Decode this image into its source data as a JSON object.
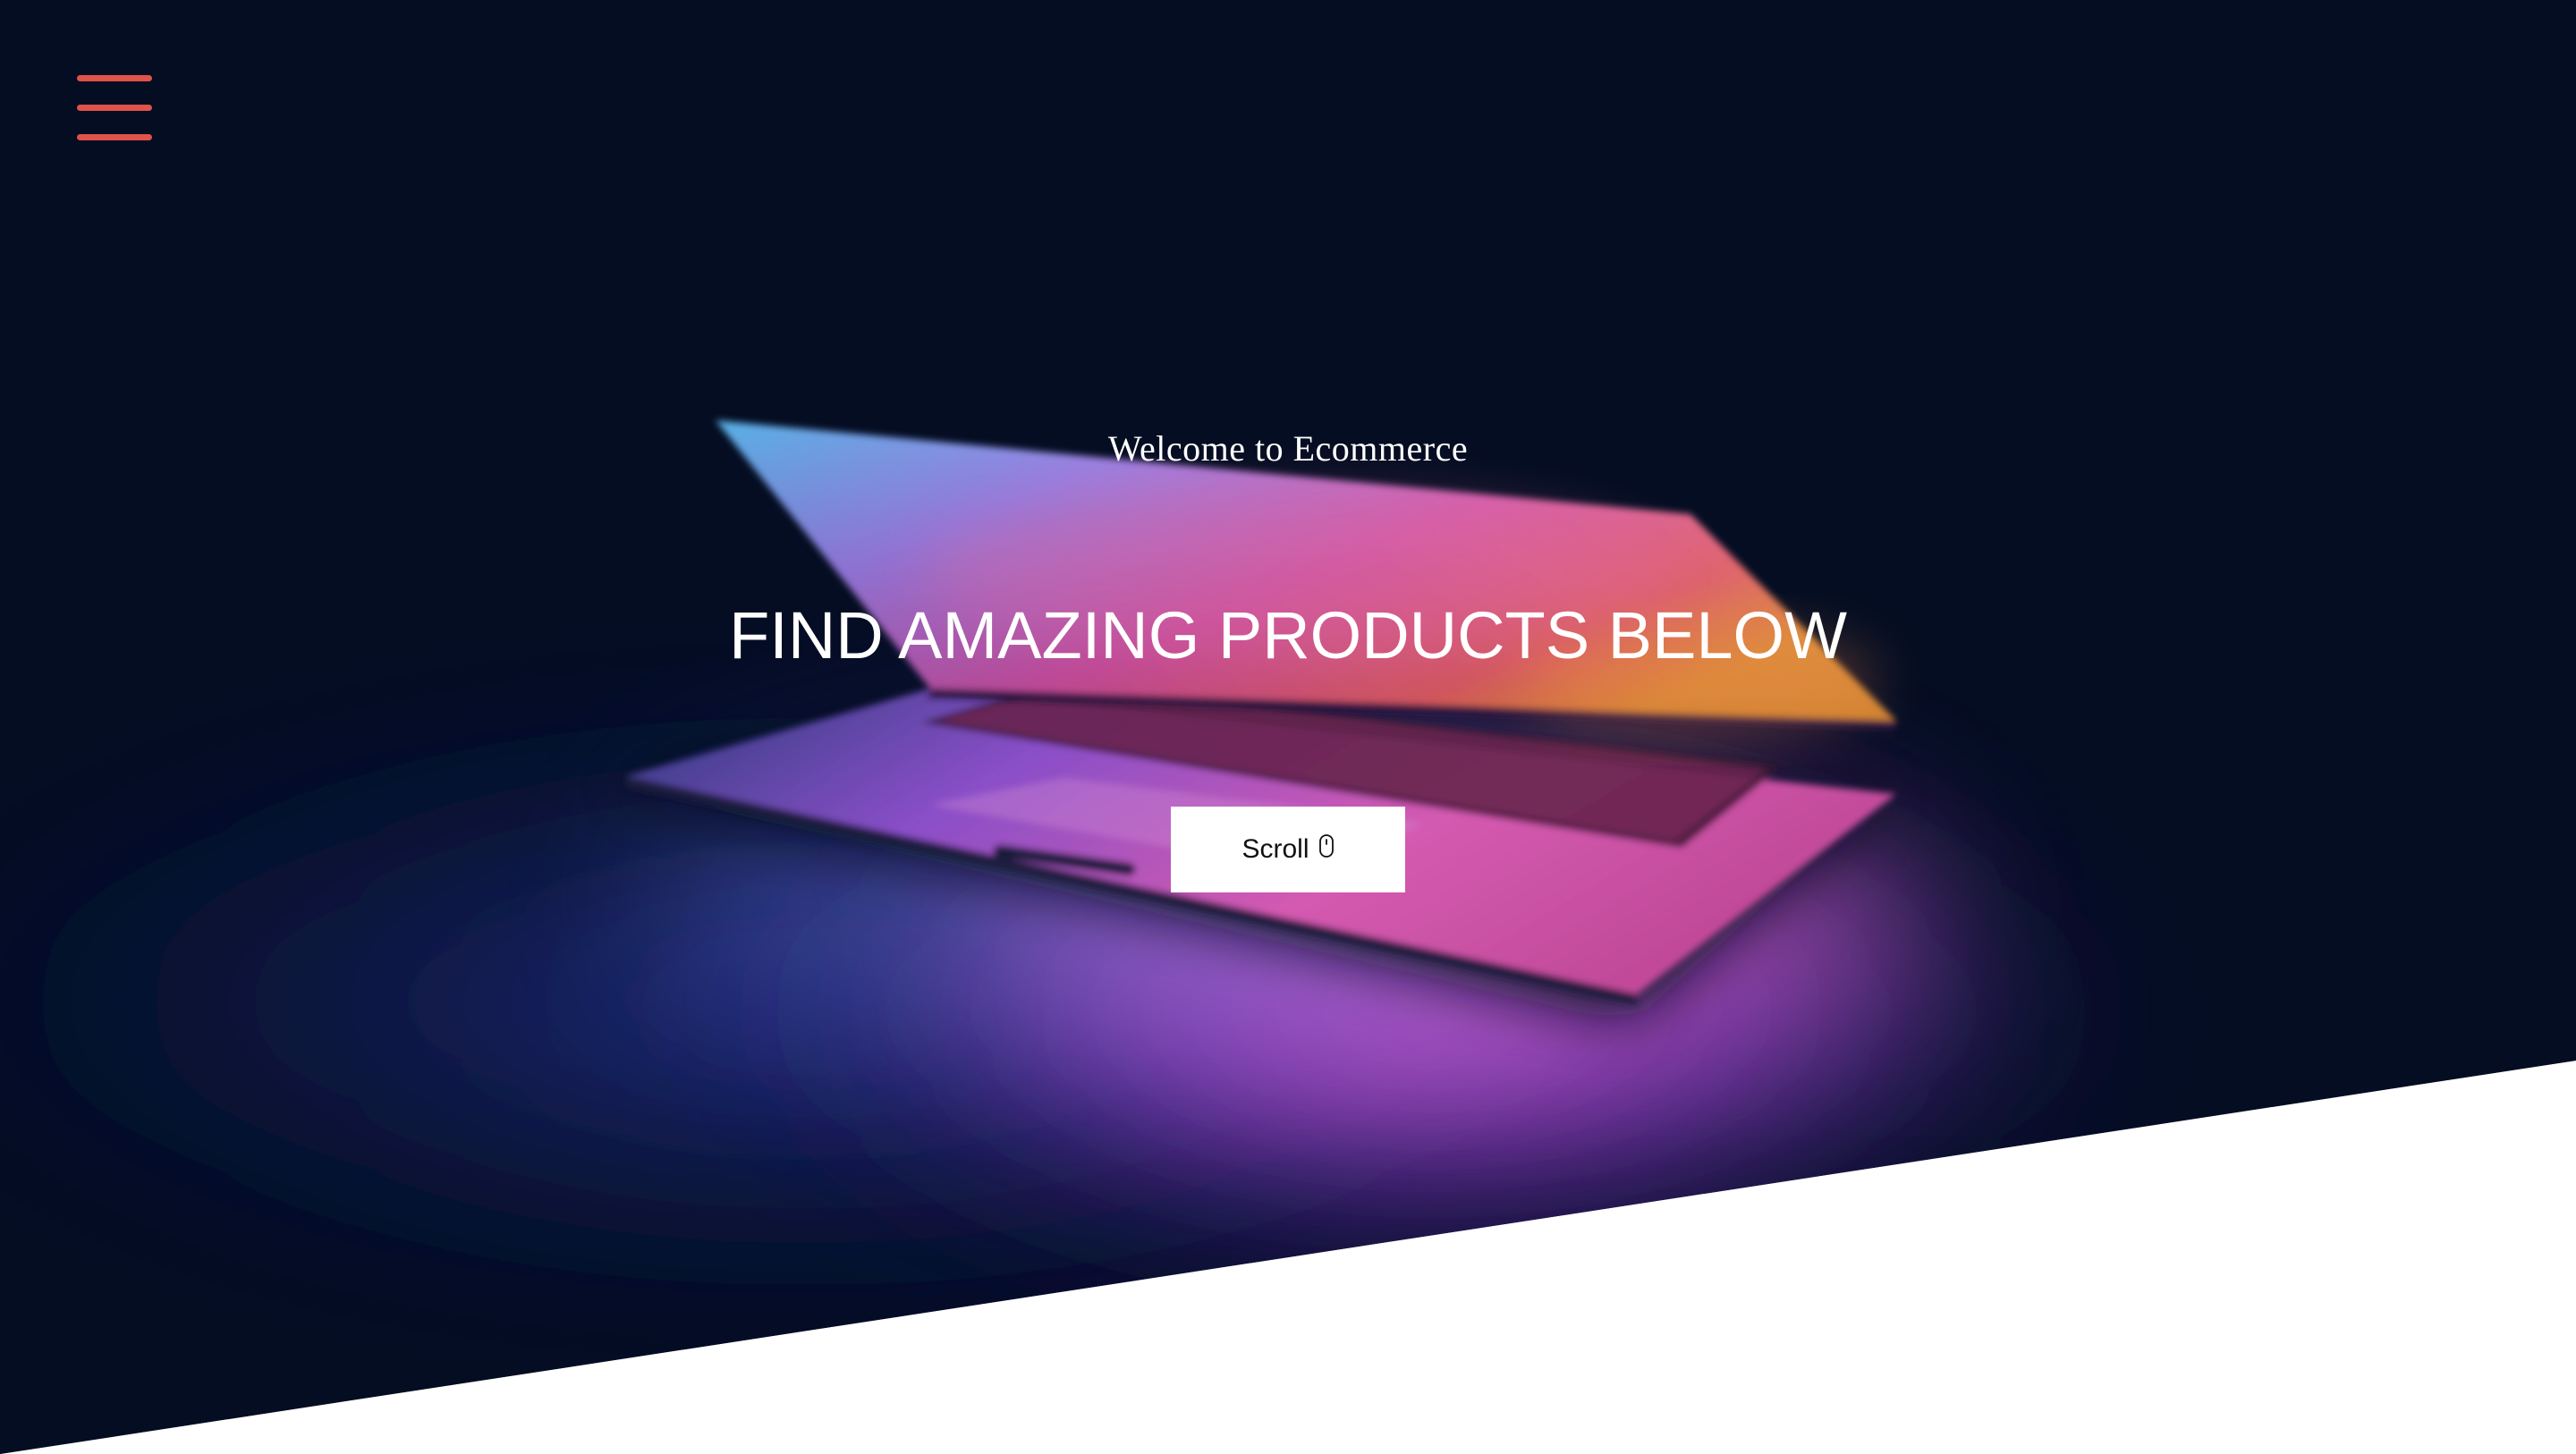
{
  "nav": {
    "menu_icon": "hamburger-menu-icon",
    "menu_color": "#e0524a"
  },
  "hero": {
    "welcome_text": "Welcome to Ecommerce",
    "headline": "FIND AMAZING PRODUCTS BELOW",
    "scroll_button": {
      "label": "Scroll",
      "icon": "mouse-icon"
    },
    "background_color": "#040d22"
  }
}
